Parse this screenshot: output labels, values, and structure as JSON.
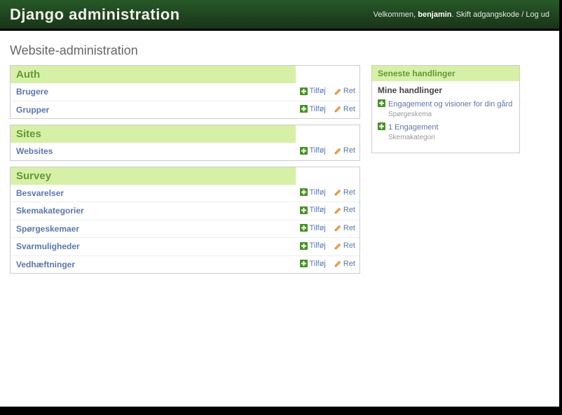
{
  "header": {
    "branding": "Django administration",
    "welcome_prefix": "Velkommen, ",
    "username": "benjamin",
    "welcome_suffix": ". ",
    "change_password": "Skift adgangskode",
    "separator": " / ",
    "logout": "Log ud"
  },
  "page_title": "Website-administration",
  "apps": [
    {
      "name": "Auth",
      "models": [
        {
          "name": "Brugere",
          "add": "Tilføj",
          "change": "Ret"
        },
        {
          "name": "Grupper",
          "add": "Tilføj",
          "change": "Ret"
        }
      ]
    },
    {
      "name": "Sites",
      "models": [
        {
          "name": "Websites",
          "add": "Tilføj",
          "change": "Ret"
        }
      ]
    },
    {
      "name": "Survey",
      "models": [
        {
          "name": "Besvarelser",
          "add": "Tilføj",
          "change": "Ret"
        },
        {
          "name": "Skemakategorier",
          "add": "Tilføj",
          "change": "Ret"
        },
        {
          "name": "Spørgeskemaer",
          "add": "Tilføj",
          "change": "Ret"
        },
        {
          "name": "Svarmuligheder",
          "add": "Tilføj",
          "change": "Ret"
        },
        {
          "name": "Vedhæftninger",
          "add": "Tilføj",
          "change": "Ret"
        }
      ]
    }
  ],
  "sidebar": {
    "caption": "Seneste handlinger",
    "heading": "Mine handlinger",
    "actions": [
      {
        "label": "Engagement og visioner for din gård",
        "type": "Spørgeskema"
      },
      {
        "label": "1 Engagement",
        "type": "Skemakategori"
      }
    ]
  }
}
